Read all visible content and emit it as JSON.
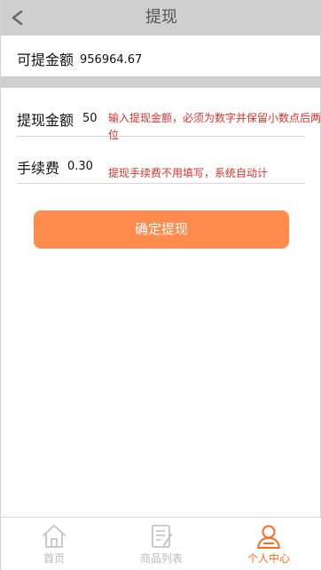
{
  "header": {
    "title": "提现",
    "back_icon": "chevron-left-icon"
  },
  "balance": {
    "label": "可提金额",
    "value": "956964.67"
  },
  "form": {
    "amount": {
      "label": "提现金额",
      "value": "50",
      "hint": "输入提现金额，必须为数字并保留小数点后两位"
    },
    "fee": {
      "label": "手续费",
      "value": "0.30",
      "hint": "提现手续费不用填写，系统自动计"
    }
  },
  "submit": {
    "label": "确定提现",
    "color": "#ff8b4c"
  },
  "tabbar": {
    "items": [
      {
        "label": "首页",
        "icon": "home-icon",
        "active": false
      },
      {
        "label": "商品列表",
        "icon": "document-list-icon",
        "active": false
      },
      {
        "label": "个人中心",
        "icon": "user-icon",
        "active": true
      }
    ],
    "active_color": "#ff6a1f",
    "inactive_color": "#bbbbbb"
  }
}
